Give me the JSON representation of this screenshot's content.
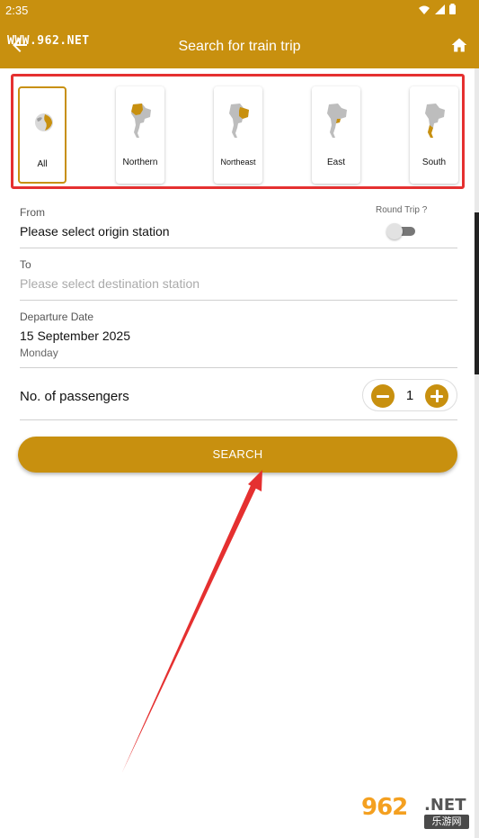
{
  "status_bar": {
    "time": "2:35",
    "icons": [
      "wifi-icon",
      "signal-icon",
      "battery-icon"
    ]
  },
  "app_bar": {
    "title": "Search for train trip",
    "back_icon": "arrow-left-icon",
    "home_icon": "home-icon"
  },
  "watermark_top": "WWW.962.NET",
  "regions": [
    {
      "label": "All",
      "icon": "globe-icon",
      "selected": true
    },
    {
      "label": "Northern",
      "icon": "thailand-map-icon",
      "selected": false
    },
    {
      "label": "Northeast",
      "icon": "thailand-map-icon",
      "selected": false
    },
    {
      "label": "East",
      "icon": "thailand-map-icon",
      "selected": false
    },
    {
      "label": "South",
      "icon": "thailand-map-icon",
      "selected": false
    }
  ],
  "form": {
    "from": {
      "caption": "From",
      "value": "Please select origin station"
    },
    "round_trip": {
      "label": "Round Trip ?",
      "enabled": false
    },
    "to": {
      "caption": "To",
      "placeholder": "Please select destination station"
    },
    "departure": {
      "caption": "Departure Date",
      "date": "15 September 2025",
      "weekday": "Monday"
    },
    "passengers": {
      "label": "No. of passengers",
      "count": "1"
    }
  },
  "search_button": "SEARCH",
  "watermark_bottom": {
    "main": "962",
    "net": ".NET",
    "sub": "乐游网"
  },
  "colors": {
    "accent": "#c8900f",
    "highlight": "#e53030",
    "map_gray": "#bdbdbd"
  }
}
